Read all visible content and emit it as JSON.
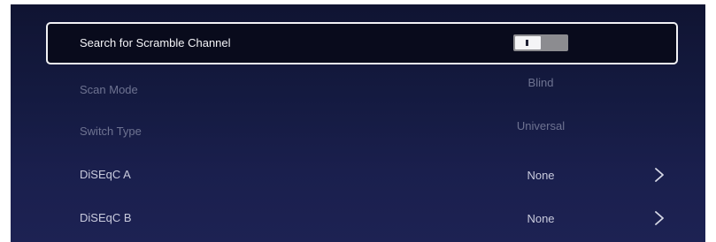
{
  "settings": {
    "search_scramble": {
      "label": "Search for Scramble Channel",
      "toggle_state": "off"
    },
    "scan_mode": {
      "label": "Scan Mode",
      "value": "Blind"
    },
    "switch_type": {
      "label": "Switch Type",
      "value": "Universal"
    },
    "diseqc_a": {
      "label": "DiSEqC A",
      "value": "None",
      "icon": "chevron-right-icon"
    },
    "diseqc_b": {
      "label": "DiSEqC B",
      "value": "None",
      "icon": "chevron-right-icon"
    }
  },
  "colors": {
    "background": "#141a40",
    "focus_border": "#f2f2f5",
    "text": "#c9cbdd",
    "text_disabled": "#6e7391"
  }
}
